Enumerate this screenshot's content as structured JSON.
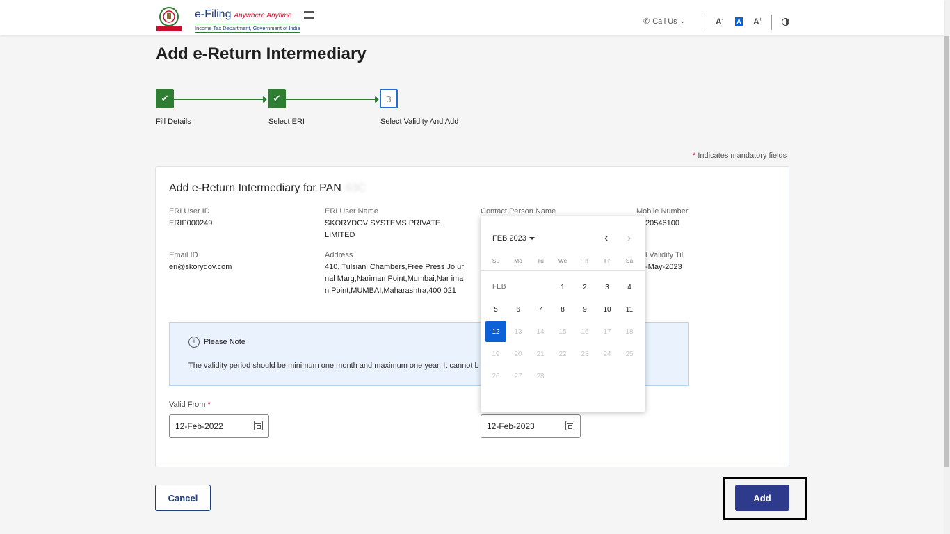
{
  "header": {
    "brand": "e-Filing",
    "tagline": "Anywhere Anytime",
    "dept": "Income Tax Department, Government of India",
    "call_us": "Call Us",
    "font_decrease": "A",
    "font_normal": "A",
    "font_increase": "A"
  },
  "page": {
    "title": "Add e-Return Intermediary"
  },
  "stepper": {
    "steps": [
      {
        "label": "Fill Details",
        "state": "done"
      },
      {
        "label": "Select ERI",
        "state": "done"
      },
      {
        "label": "Select Validity And Add",
        "state": "current",
        "number": "3"
      }
    ]
  },
  "mandatory_note": "Indicates mandatory fields",
  "card": {
    "title": "Add e-Return Intermediary for PAN",
    "pan": "63C",
    "fields": {
      "eri_user_id_label": "ERI User ID",
      "eri_user_id": "ERIP000249",
      "eri_user_name_label": "ERI User Name",
      "eri_user_name": "SKORYDOV SYSTEMS PRIVATE LIMITED",
      "contact_person_label": "Contact Person Name",
      "mobile_label": "Mobile Number",
      "mobile": "20546100",
      "email_label": "Email ID",
      "email": "eri@skorydov.com",
      "address_label": "Address",
      "address": "410, Tulsiani Chambers,Free Press Jo urnal Marg,Nariman Point,Mumbai,Nar iman Point,MUMBAI,Maharashtra,400 021",
      "validity_label": "l Validity Till",
      "validity": "-May-2023"
    },
    "note": {
      "heading": "Please Note",
      "text": "The validity period should be minimum one month and maximum one year. It cannot b"
    },
    "valid_from_label": "Valid From",
    "valid_from": "12-Feb-2022",
    "valid_to": "12-Feb-2023"
  },
  "datepicker": {
    "period": "FEB 2023",
    "month_short": "FEB",
    "weekdays": [
      "Su",
      "Mo",
      "Tu",
      "We",
      "Th",
      "Fr",
      "Sa"
    ],
    "selected_day": "12"
  },
  "actions": {
    "cancel": "Cancel",
    "add": "Add"
  }
}
